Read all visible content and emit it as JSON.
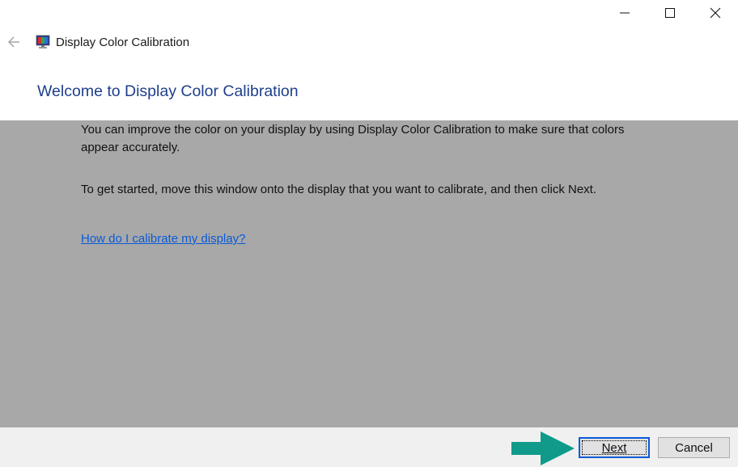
{
  "window": {
    "controls": {
      "minimize_icon": "minimize-icon",
      "maximize_icon": "maximize-icon",
      "close_icon": "close-icon"
    }
  },
  "nav": {
    "back_icon": "back-arrow-icon",
    "app_icon": "display-color-calibration-icon",
    "app_title": "Display Color Calibration"
  },
  "page": {
    "heading": "Welcome to Display Color Calibration",
    "paragraph1": "You can improve the color on your display by using Display Color Calibration to make sure that colors appear accurately.",
    "paragraph2": "To get started, move this window onto the display that you want to calibrate, and then click Next.",
    "help_link": "How do I calibrate my display?"
  },
  "footer": {
    "next_label": "Next",
    "cancel_label": "Cancel",
    "pointer_icon": "pointer-arrow-icon"
  },
  "colors": {
    "heading": "#1e3f8a",
    "link": "#0a5bd6",
    "content_background": "#a8a8a8",
    "footer_background": "#f0f0f0",
    "pointer_arrow": "#0f9a8a"
  }
}
